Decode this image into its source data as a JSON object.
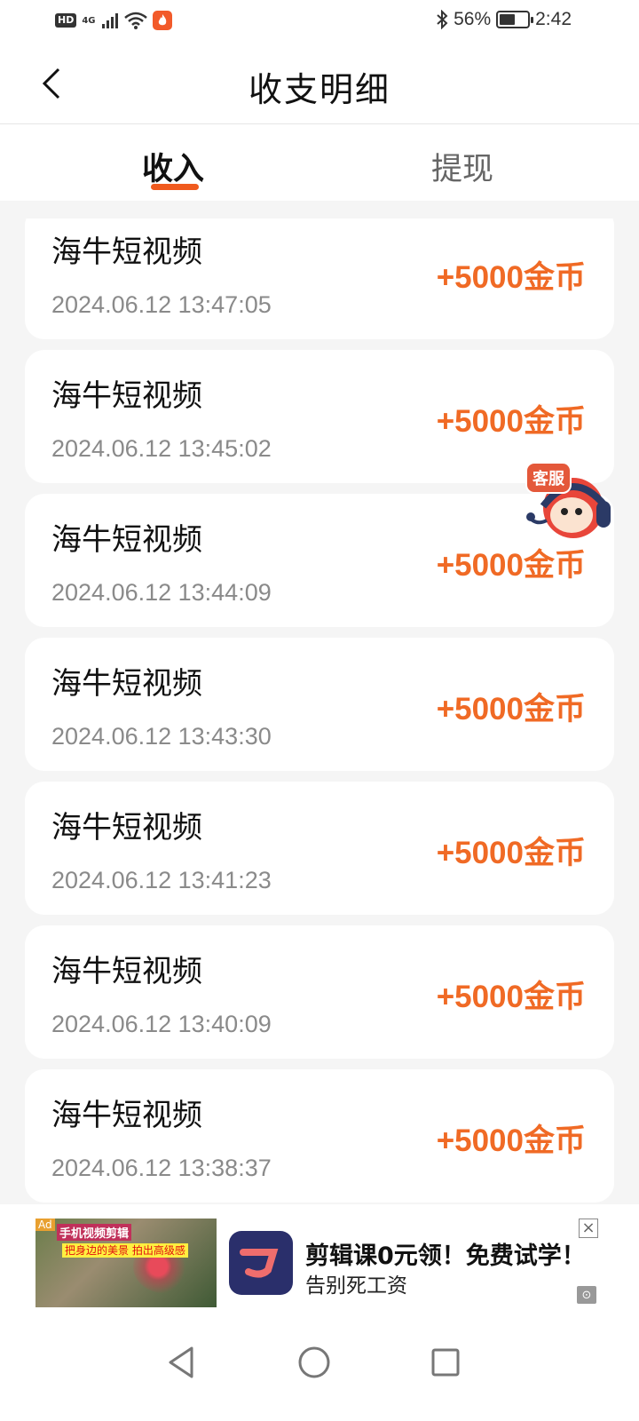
{
  "status_bar": {
    "network_badge": "HD",
    "network_type": "4G",
    "battery": "56%",
    "battery_level": 0.56,
    "time": "2:42"
  },
  "header": {
    "title": "收支明细"
  },
  "tabs": [
    {
      "label": "收入",
      "active": true
    },
    {
      "label": "提现",
      "active": false
    }
  ],
  "records": [
    {
      "source": "海牛短视频",
      "time": "2024.06.12 13:47:05",
      "amount": "+5000金币"
    },
    {
      "source": "海牛短视频",
      "time": "2024.06.12 13:45:02",
      "amount": "+5000金币"
    },
    {
      "source": "海牛短视频",
      "time": "2024.06.12 13:44:09",
      "amount": "+5000金币"
    },
    {
      "source": "海牛短视频",
      "time": "2024.06.12 13:43:30",
      "amount": "+5000金币"
    },
    {
      "source": "海牛短视频",
      "time": "2024.06.12 13:41:23",
      "amount": "+5000金币"
    },
    {
      "source": "海牛短视频",
      "time": "2024.06.12 13:40:09",
      "amount": "+5000金币"
    },
    {
      "source": "海牛短视频",
      "time": "2024.06.12 13:38:37",
      "amount": "+5000金币"
    }
  ],
  "customer_service": {
    "label": "客服"
  },
  "ad": {
    "tag": "Ad",
    "image_text_1": "手机视频剪辑",
    "image_text_2": "把身边的美景 拍出高级感",
    "title": "剪辑课0元领！免费试学！",
    "subtitle": "告别死工资",
    "close_icon": "close-icon",
    "info_icon": "ad-info-icon"
  },
  "colors": {
    "accent": "#f05a1e",
    "amount": "#f06a25",
    "background": "#f5f5f5"
  }
}
